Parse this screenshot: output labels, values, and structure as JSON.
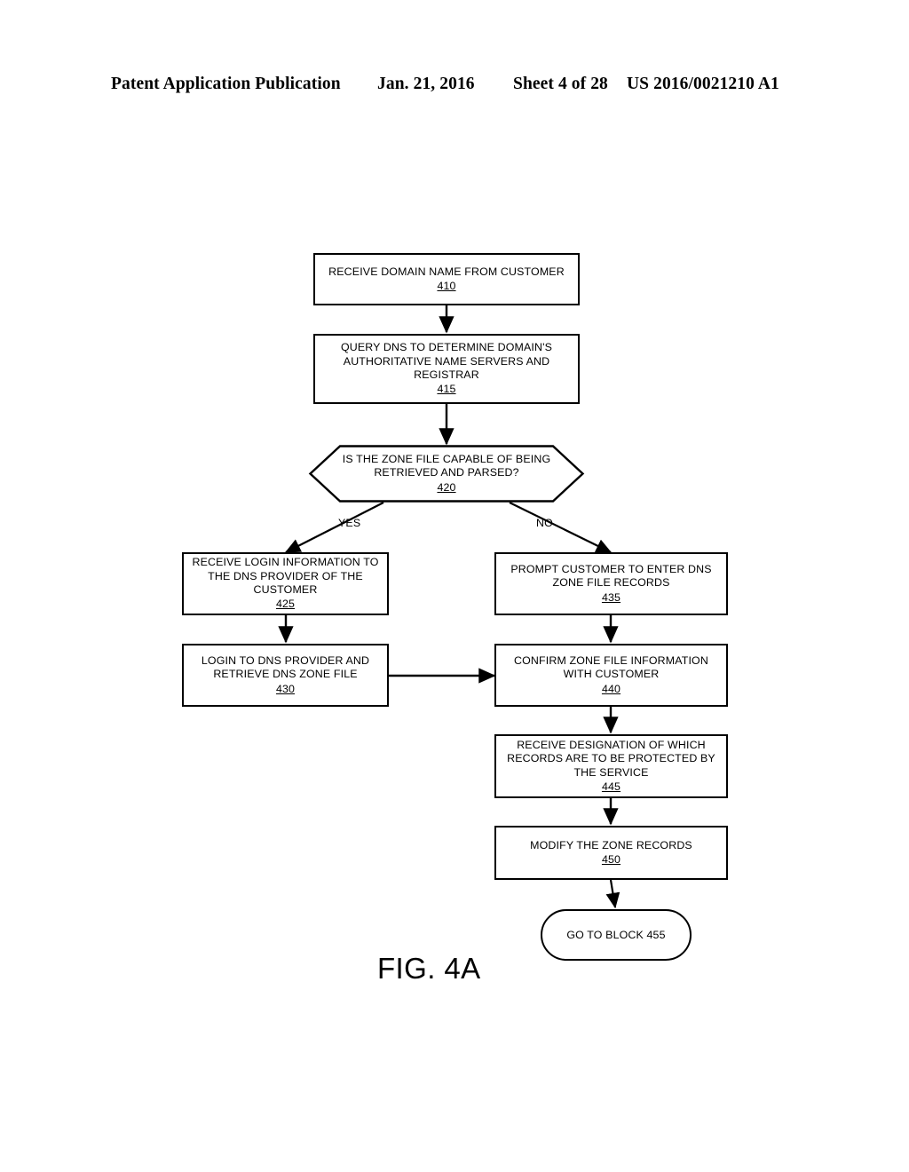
{
  "header": {
    "publication": "Patent Application Publication",
    "date": "Jan. 21, 2016",
    "sheet": "Sheet 4 of 28",
    "patent_number": "US 2016/0021210 A1"
  },
  "figure": {
    "caption": "FIG. 4A"
  },
  "flowchart": {
    "type": "flowchart",
    "nodes": {
      "n410": {
        "text": "RECEIVE DOMAIN NAME FROM CUSTOMER",
        "ref": "410",
        "shape": "process"
      },
      "n415": {
        "text": "QUERY DNS TO DETERMINE DOMAIN'S\nAUTHORITATIVE NAME SERVERS AND\nREGISTRAR",
        "ref": "415",
        "shape": "process"
      },
      "n420": {
        "text": "IS THE ZONE FILE CAPABLE OF BEING\nRETRIEVED AND PARSED?",
        "ref": "420",
        "shape": "decision-hexagon"
      },
      "n425": {
        "text": "RECEIVE LOGIN INFORMATION TO\nTHE DNS PROVIDER OF THE\nCUSTOMER",
        "ref": "425",
        "shape": "process"
      },
      "n430": {
        "text": "LOGIN TO DNS PROVIDER AND\nRETRIEVE DNS ZONE FILE",
        "ref": "430",
        "shape": "process"
      },
      "n435": {
        "text": "PROMPT CUSTOMER TO ENTER DNS\nZONE FILE RECORDS",
        "ref": "435",
        "shape": "process"
      },
      "n440": {
        "text": "CONFIRM ZONE FILE INFORMATION\nWITH CUSTOMER",
        "ref": "440",
        "shape": "process"
      },
      "n445": {
        "text": "RECEIVE DESIGNATION OF WHICH\nRECORDS ARE TO BE PROTECTED BY\nTHE SERVICE",
        "ref": "445",
        "shape": "process"
      },
      "n450": {
        "text": "MODIFY THE ZONE RECORDS",
        "ref": "450",
        "shape": "process"
      },
      "n455": {
        "text": "GO TO BLOCK 455",
        "shape": "terminal"
      }
    },
    "branch_labels": {
      "yes": "YES",
      "no": "NO"
    },
    "edges": [
      {
        "from": "n410",
        "to": "n415",
        "label": ""
      },
      {
        "from": "n415",
        "to": "n420",
        "label": ""
      },
      {
        "from": "n420",
        "to": "n425",
        "label": "YES"
      },
      {
        "from": "n420",
        "to": "n435",
        "label": "NO"
      },
      {
        "from": "n425",
        "to": "n430",
        "label": ""
      },
      {
        "from": "n430",
        "to": "n440",
        "label": ""
      },
      {
        "from": "n435",
        "to": "n440",
        "label": ""
      },
      {
        "from": "n440",
        "to": "n445",
        "label": ""
      },
      {
        "from": "n445",
        "to": "n450",
        "label": ""
      },
      {
        "from": "n450",
        "to": "n455",
        "label": ""
      }
    ]
  },
  "colors": {
    "ink": "#000000",
    "paper": "#ffffff"
  }
}
